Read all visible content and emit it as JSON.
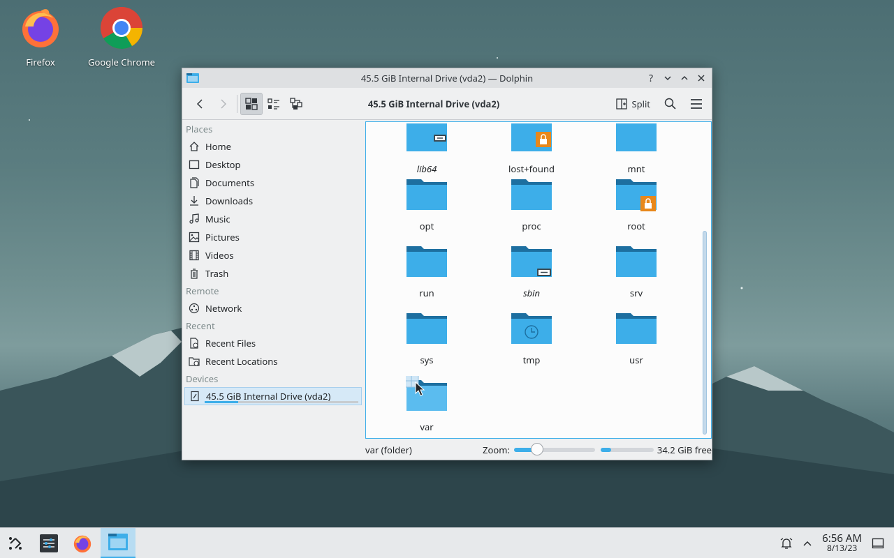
{
  "desktop": {
    "icons": [
      {
        "label": "Firefox"
      },
      {
        "label": "Google Chrome"
      }
    ]
  },
  "window": {
    "title": "45.5 GiB Internal Drive (vda2) — Dolphin",
    "toolbar": {
      "location": "45.5 GiB Internal Drive (vda2)",
      "split_label": "Split"
    },
    "sidebar": {
      "sections": {
        "places": "Places",
        "remote": "Remote",
        "recent": "Recent",
        "devices": "Devices"
      },
      "places": [
        "Home",
        "Desktop",
        "Documents",
        "Downloads",
        "Music",
        "Pictures",
        "Videos",
        "Trash"
      ],
      "remote": [
        "Network"
      ],
      "recent": [
        "Recent Files",
        "Recent Locations"
      ],
      "devices": [
        "45.5 GiB Internal Drive (vda2)"
      ]
    },
    "files": [
      {
        "name": "lib64",
        "italic": true,
        "emblem": "link"
      },
      {
        "name": "lost+found",
        "italic": false,
        "emblem": "lock"
      },
      {
        "name": "mnt",
        "italic": false,
        "emblem": ""
      },
      {
        "name": "opt",
        "italic": false,
        "emblem": ""
      },
      {
        "name": "proc",
        "italic": false,
        "emblem": ""
      },
      {
        "name": "root",
        "italic": false,
        "emblem": "lock"
      },
      {
        "name": "run",
        "italic": false,
        "emblem": ""
      },
      {
        "name": "sbin",
        "italic": true,
        "emblem": "link"
      },
      {
        "name": "srv",
        "italic": false,
        "emblem": ""
      },
      {
        "name": "sys",
        "italic": false,
        "emblem": ""
      },
      {
        "name": "tmp",
        "italic": false,
        "emblem": "clock"
      },
      {
        "name": "usr",
        "italic": false,
        "emblem": ""
      },
      {
        "name": "var",
        "italic": false,
        "emblem": "hover"
      }
    ],
    "status": {
      "selection": "var (folder)",
      "zoom_label": "Zoom:",
      "free_space": "34.2 GiB free"
    }
  },
  "taskbar": {
    "time": "6:56 AM",
    "date": "8/13/23"
  },
  "colors": {
    "accent": "#3daee9",
    "folder": "#3daee9",
    "folder_tab": "#1d6fa0",
    "lock": "#e8881b"
  }
}
